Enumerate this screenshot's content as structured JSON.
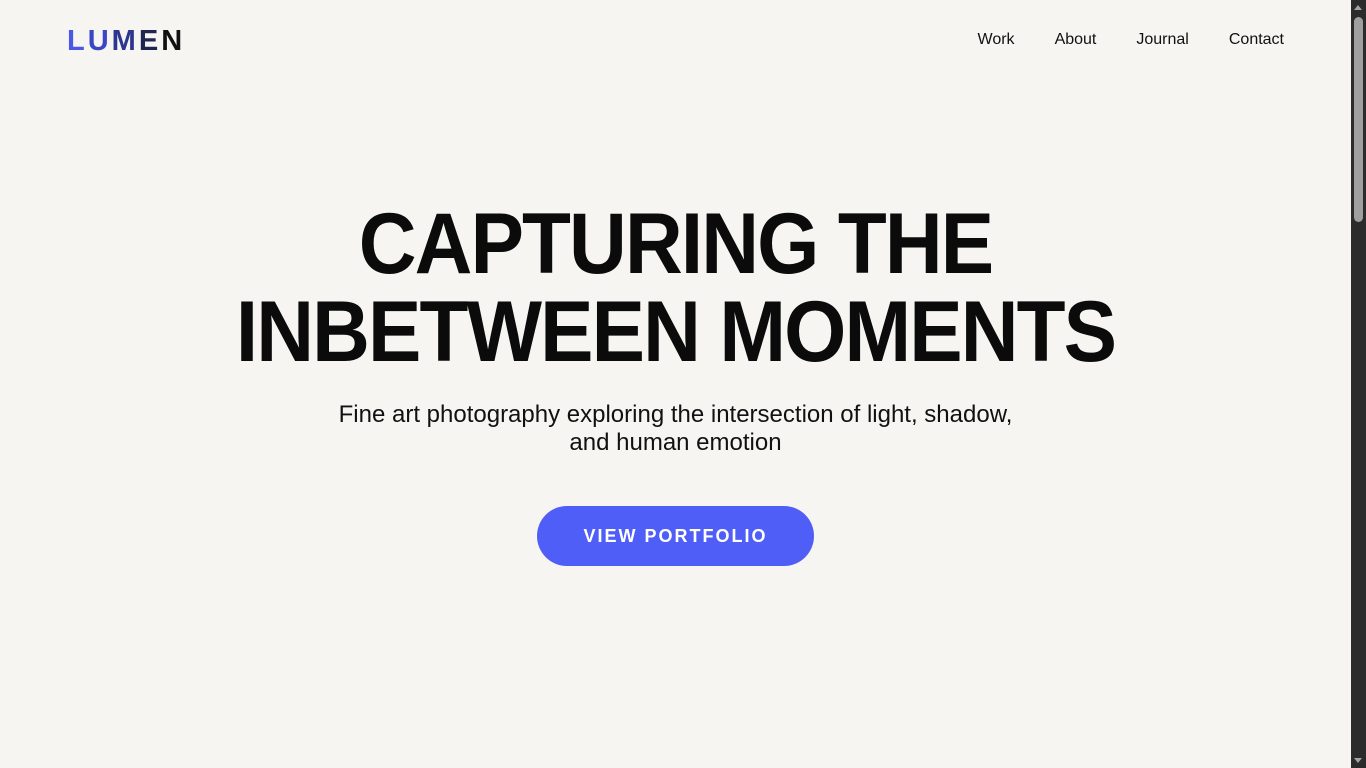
{
  "brand": {
    "letters": [
      "L",
      "U",
      "M",
      "E",
      "N"
    ],
    "letter_colors": [
      "#4a58e6",
      "#3a46c4",
      "#2c3590",
      "#1f2552",
      "#111111"
    ]
  },
  "nav": {
    "items": [
      {
        "label": "Work"
      },
      {
        "label": "About"
      },
      {
        "label": "Journal"
      },
      {
        "label": "Contact"
      }
    ]
  },
  "hero": {
    "title_lines": [
      "CAPTURING THE",
      "INBETWEEN MOMENTS"
    ],
    "subtitle_lines": [
      "Fine art photography exploring the intersection of light, shadow,",
      "and human emotion"
    ],
    "cta_label": "VIEW PORTFOLIO"
  },
  "colors": {
    "background": "#f6f5f1",
    "accent": "#4f5ef7",
    "text": "#0d0d0d"
  }
}
